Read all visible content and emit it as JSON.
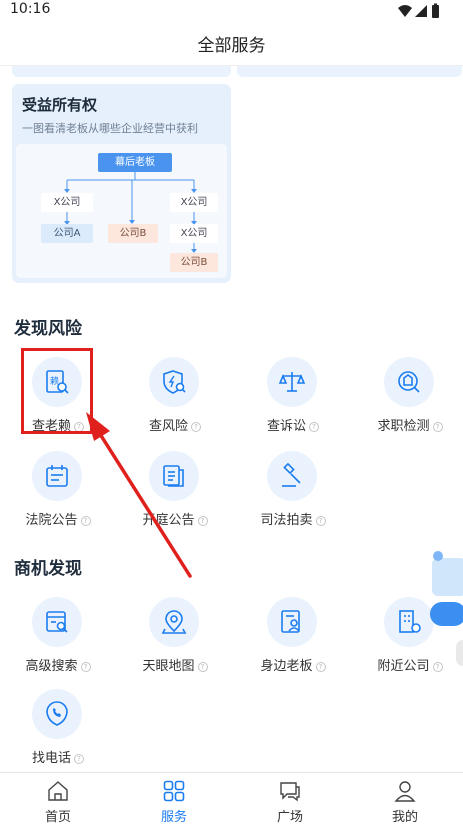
{
  "status_bar": {
    "time": "10:16"
  },
  "header": {
    "title": "全部服务"
  },
  "feature_card": {
    "title": "受益所有权",
    "subtitle": "一图看清老板从哪些企业经营中获利",
    "diagram": {
      "root": "幕后老板",
      "x_company": "X公司",
      "company_a": "公司A",
      "company_b": "公司B"
    }
  },
  "sections": {
    "risk": {
      "title": "发现风险",
      "items": [
        {
          "label": "查老赖",
          "icon": "laolai-search-icon"
        },
        {
          "label": "查风险",
          "icon": "risk-shield-icon"
        },
        {
          "label": "查诉讼",
          "icon": "lawsuit-scale-icon"
        },
        {
          "label": "求职检测",
          "icon": "job-check-icon"
        },
        {
          "label": "法院公告",
          "icon": "court-calendar-icon"
        },
        {
          "label": "开庭公告",
          "icon": "hearing-document-icon"
        },
        {
          "label": "司法拍卖",
          "icon": "auction-gavel-icon"
        }
      ]
    },
    "business": {
      "title": "商机发现",
      "items": [
        {
          "label": "高级搜索",
          "icon": "advanced-search-icon"
        },
        {
          "label": "天眼地图",
          "icon": "map-pin-icon"
        },
        {
          "label": "身边老板",
          "icon": "nearby-boss-icon"
        },
        {
          "label": "附近公司",
          "icon": "nearby-company-icon"
        },
        {
          "label": "找电话",
          "icon": "phone-icon"
        }
      ]
    }
  },
  "bottom_nav": {
    "items": [
      {
        "label": "首页",
        "icon": "home-icon",
        "active": false
      },
      {
        "label": "服务",
        "icon": "services-grid-icon",
        "active": true
      },
      {
        "label": "广场",
        "icon": "square-chat-icon",
        "active": false
      },
      {
        "label": "我的",
        "icon": "profile-icon",
        "active": false
      }
    ]
  },
  "help_glyph": "?",
  "colors": {
    "accent": "#1b7cf0",
    "highlight": "#e0201c",
    "icon_bg": "#eaf3fd"
  }
}
